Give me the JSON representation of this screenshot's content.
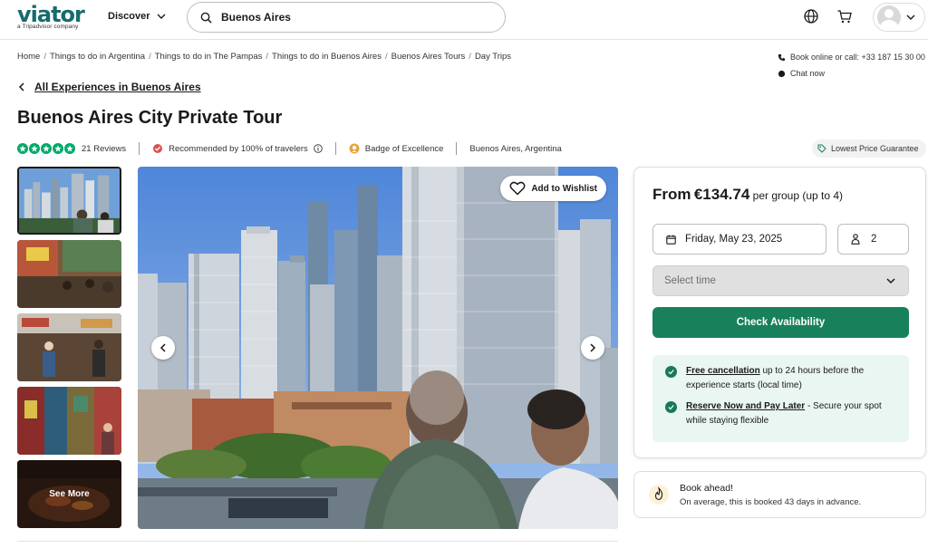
{
  "header": {
    "logo": "viator",
    "logo_sub": "a Tripadvisor company",
    "discover_label": "Discover",
    "search_value": "Buenos Aires"
  },
  "breadcrumb": [
    "Home",
    "Things to do in Argentina",
    "Things to do in The Pampas",
    "Things to do in Buenos Aires",
    "Buenos Aires Tours",
    "Day Trips"
  ],
  "contact": {
    "phone_label": "Book online or call: +33 187 15 30 00",
    "chat_label": "Chat now"
  },
  "back_link": "All Experiences in Buenos Aires",
  "title": "Buenos Aires City Private Tour",
  "meta": {
    "rating": 5,
    "reviews": "21 Reviews",
    "recommended": "Recommended by 100% of travelers",
    "badge": "Badge of Excellence",
    "location": "Buenos Aires, Argentina",
    "lowest_price": "Lowest Price Guarantee"
  },
  "gallery": {
    "see_more": "See More",
    "wishlist_label": "Add to Wishlist"
  },
  "booking": {
    "price_prefix": "From",
    "price": "€134.74",
    "price_suffix": "per group (up to 4)",
    "date": "Friday, May 23, 2025",
    "travelers": "2",
    "time_placeholder": "Select time",
    "check_label": "Check Availability",
    "perks": [
      {
        "title": "Free cancellation",
        "text": " up to 24 hours before the experience starts (local time)"
      },
      {
        "title": "Reserve Now and Pay Later",
        "text": " - Secure your spot while staying flexible"
      }
    ]
  },
  "book_ahead": {
    "title": "Book ahead!",
    "text": "On average, this is booked 43 days in advance."
  },
  "colors": {
    "brand": "#186b6d",
    "accent": "#18815b",
    "star": "#00aa6c"
  }
}
